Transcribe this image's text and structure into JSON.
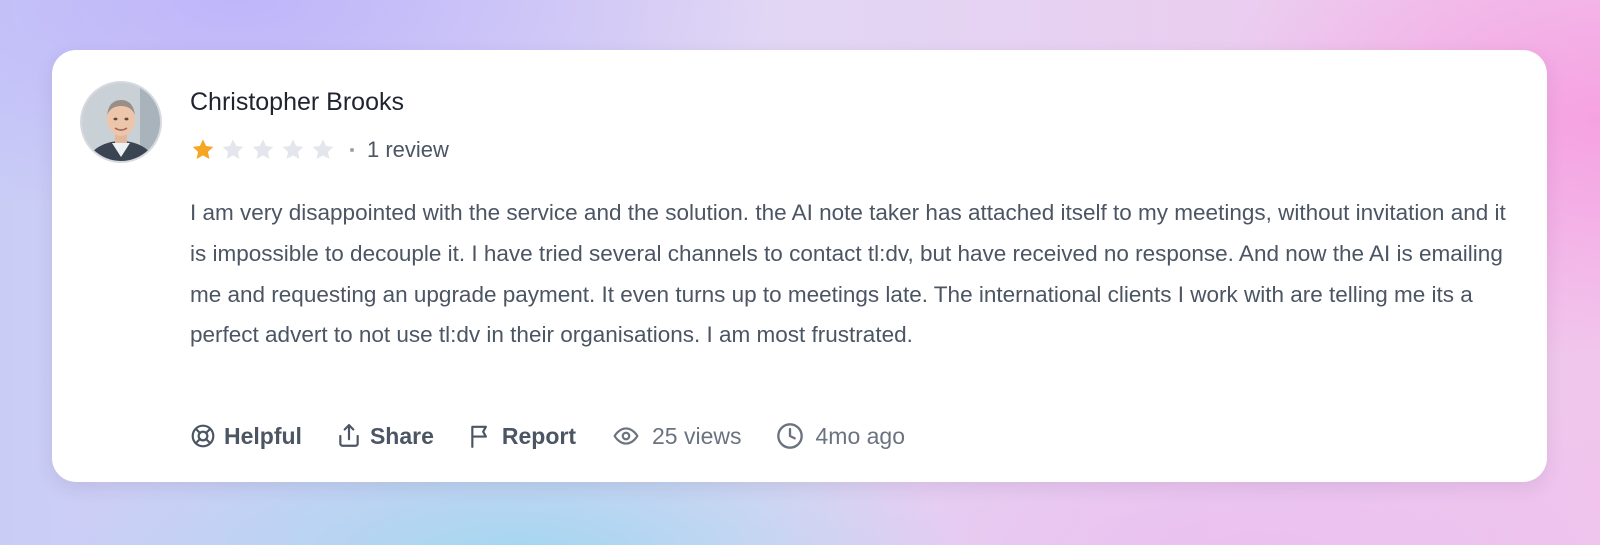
{
  "review": {
    "author": "Christopher Brooks",
    "rating": 1,
    "max_rating": 5,
    "review_count": "1 review",
    "text": "I am very disappointed with the service and the solution. the AI note taker has attached itself to my meetings, without invitation and it is impossible to decouple it. I have tried several channels to contact tl:dv, but have received no response. And now the AI is emailing me and requesting an upgrade payment. It even turns up to meetings late. The international clients I work with are telling me its a perfect advert to not use tl:dv in their organisations. I am most frustrated."
  },
  "actions": {
    "helpful": "Helpful",
    "share": "Share",
    "report": "Report"
  },
  "meta": {
    "views": "25 views",
    "time_ago": "4mo ago"
  },
  "icons": {
    "helpful": "lifebuoy-icon",
    "share": "share-upload-icon",
    "report": "flag-icon",
    "views": "eye-icon",
    "time": "clock-icon"
  },
  "colors": {
    "star_filled": "#f5a623",
    "star_empty": "#e3e6ec",
    "text": "#4b5563",
    "author": "#1f2430"
  }
}
